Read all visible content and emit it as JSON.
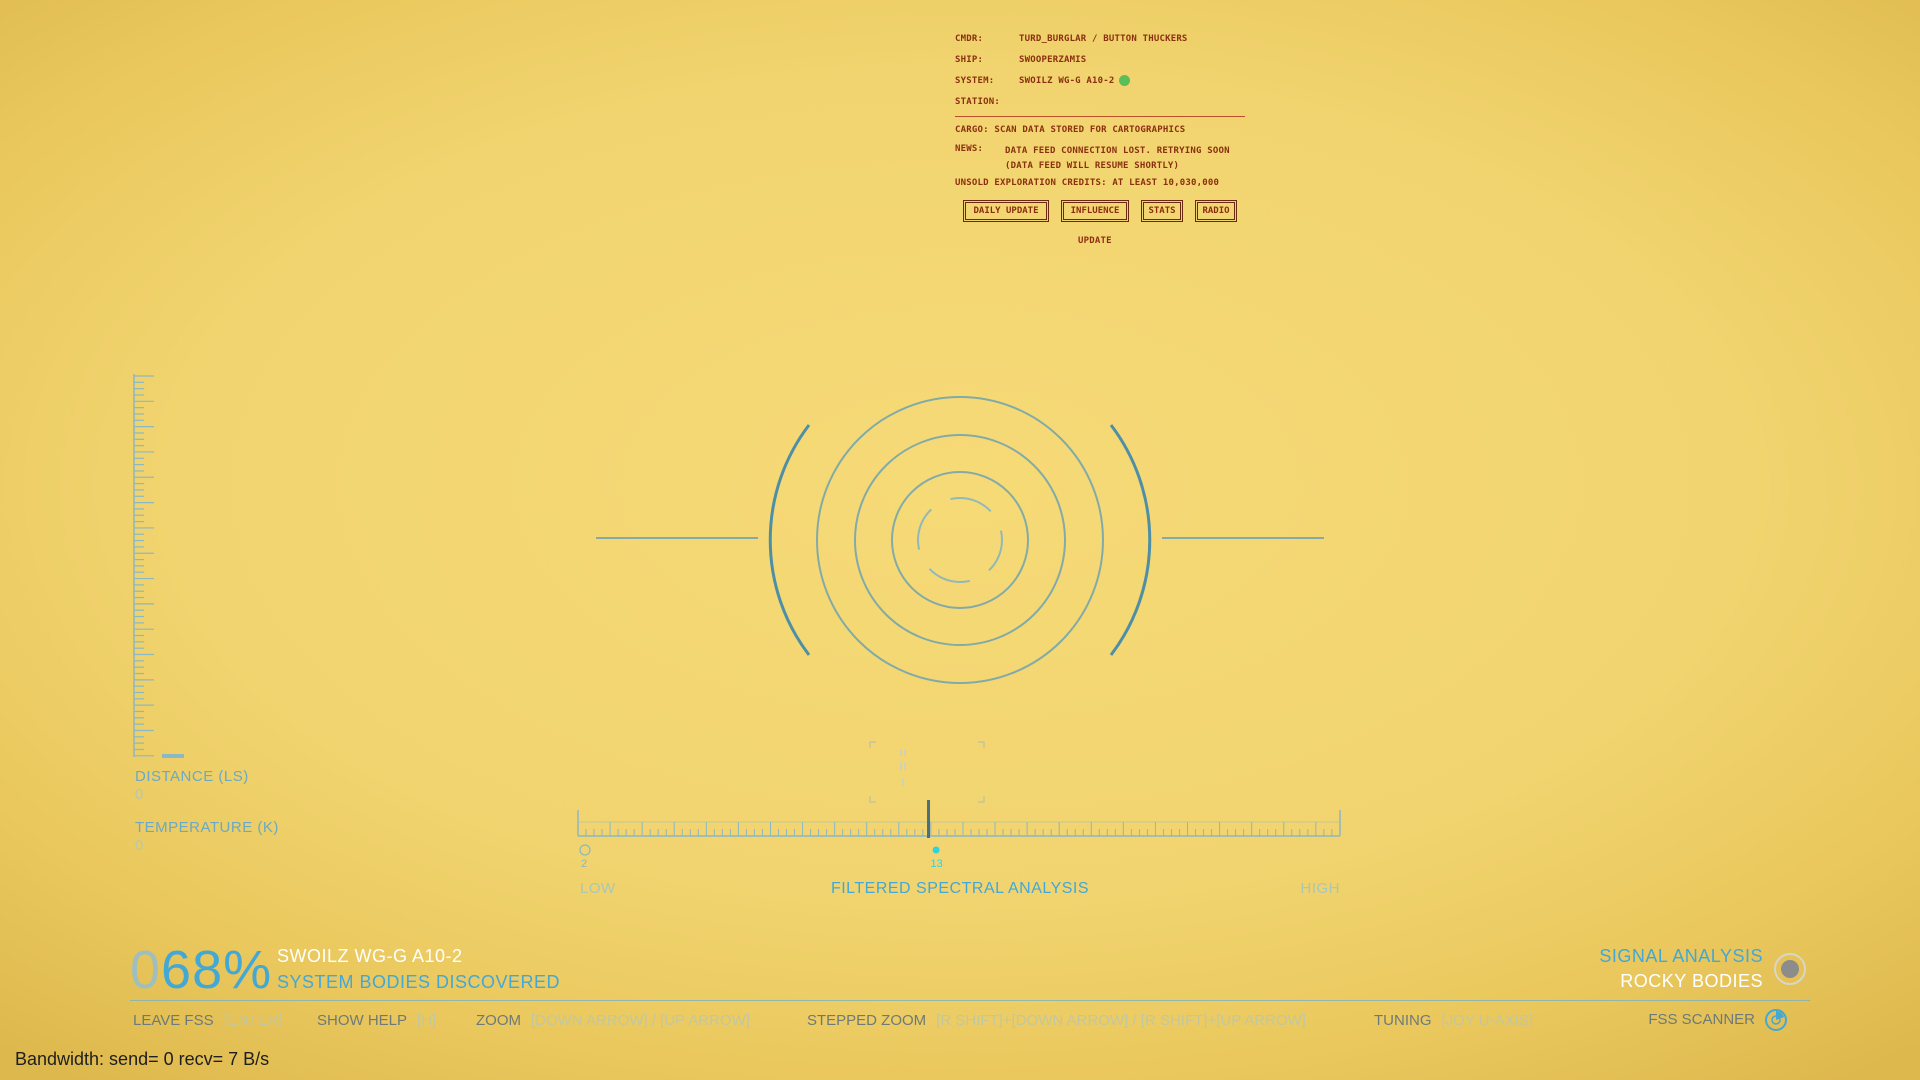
{
  "info_panel": {
    "rows": [
      {
        "key": "CMDR:",
        "value": "TURD_BURGLAR / BUTTON THUCKERS"
      },
      {
        "key": "SHIP:",
        "value": "SWOOPERZAMIS"
      },
      {
        "key": "SYSTEM:",
        "value": "SWOILZ WG-G A10-2"
      },
      {
        "key": "STATION:",
        "value": ""
      }
    ],
    "status_dot_color": "#5cbe5a",
    "cargo_text": "CARGO: SCAN DATA STORED FOR CARTOGRAPHICS",
    "news_key": "NEWS:",
    "news_value": "DATA FEED CONNECTION LOST. RETRYING SOON (DATA FEED WILL RESUME SHORTLY)",
    "credits_text": "UNSOLD EXPLORATION CREDITS: AT LEAST 10,030,000",
    "buttons": [
      "DAILY UPDATE",
      "INFLUENCE",
      "STATS",
      "RADIO"
    ],
    "update_label": "UPDATE"
  },
  "left_gauge": {
    "distance_label": "DISTANCE (LS)",
    "distance_value": "0",
    "temperature_label": "TEMPERATURE (K)",
    "temperature_value": "0",
    "level": 0
  },
  "spectrum": {
    "low_label": "LOW",
    "high_label": "HIGH",
    "title": "FILTERED SPECTRAL ANALYSIS",
    "left_marker": "2",
    "cursor_marker": "13",
    "cursor_position": 0.46,
    "signal_position": 0.47
  },
  "discovery": {
    "percent_dim": "0",
    "percent_main": "68%",
    "system_name": "SWOILZ WG-G A10-2",
    "bodies_label": "SYSTEM BODIES DISCOVERED"
  },
  "controls": [
    {
      "action": "LEAVE FSS",
      "key": "[ENTER]"
    },
    {
      "action": "SHOW HELP",
      "key": "[H]"
    },
    {
      "action": "ZOOM",
      "key": "[DOWN ARROW] / [UP ARROW]"
    },
    {
      "action": "STEPPED ZOOM",
      "key": "[R SHIFT]+[DOWN ARROW] / [R SHIFT]+[UP ARROW]"
    },
    {
      "action": "TUNING",
      "key": "[JOY U-AXIS]"
    }
  ],
  "signal": {
    "analysis_label": "SIGNAL ANALYSIS",
    "body_type": "ROCKY BODIES",
    "icon": "target-icon"
  },
  "fss_scanner_label": "FSS SCANNER",
  "fss_scanner_icon": "scanner-icon",
  "bandwidth_text": "Bandwidth: send=   0 recv=   7 B/s",
  "colors": {
    "hud_blue": "#42a8d6",
    "panel_text": "#8a2f10",
    "reticle": "#4f8fa5"
  }
}
